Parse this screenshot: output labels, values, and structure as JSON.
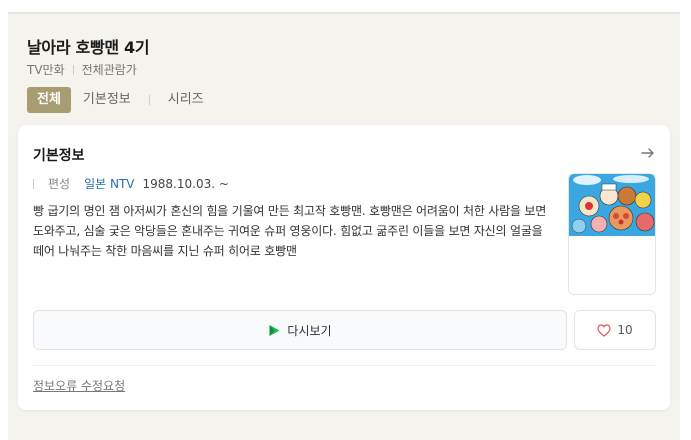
{
  "header": {
    "title": "날아라 호빵맨 4기",
    "meta": [
      "TV만화",
      "전체관람가"
    ]
  },
  "tabs": [
    {
      "label": "전체",
      "active": true
    },
    {
      "label": "기본정보",
      "active": false
    },
    {
      "label": "시리즈",
      "active": false
    }
  ],
  "card": {
    "title": "기본정보",
    "arrow_icon": "arrow-right-icon",
    "info": {
      "label": "편성",
      "channel": "일본 NTV",
      "date": "1988.10.03. ~"
    },
    "description": "빵 굽기의 명인 잼 아저씨가 혼신의 힘을 기울여 만든 최고작 호빵맨. 호빵맨은 어려움이 처한 사람을 보면 도와주고, 심술 궂은 악당들은 혼내주는 귀여운 슈퍼 영웅이다. 힘없고 굶주린 이들을 보면 자신의 얼굴을 떼어 나눠주는 착한 마음씨를 지닌 슈퍼 히어로 호빵맨",
    "replay_label": "다시보기",
    "like_count": "10",
    "report_label": "정보오류 수정요청"
  },
  "colors": {
    "accent": "#a89c72",
    "channel": "#2a6fb0",
    "play_green": "#1db954"
  }
}
